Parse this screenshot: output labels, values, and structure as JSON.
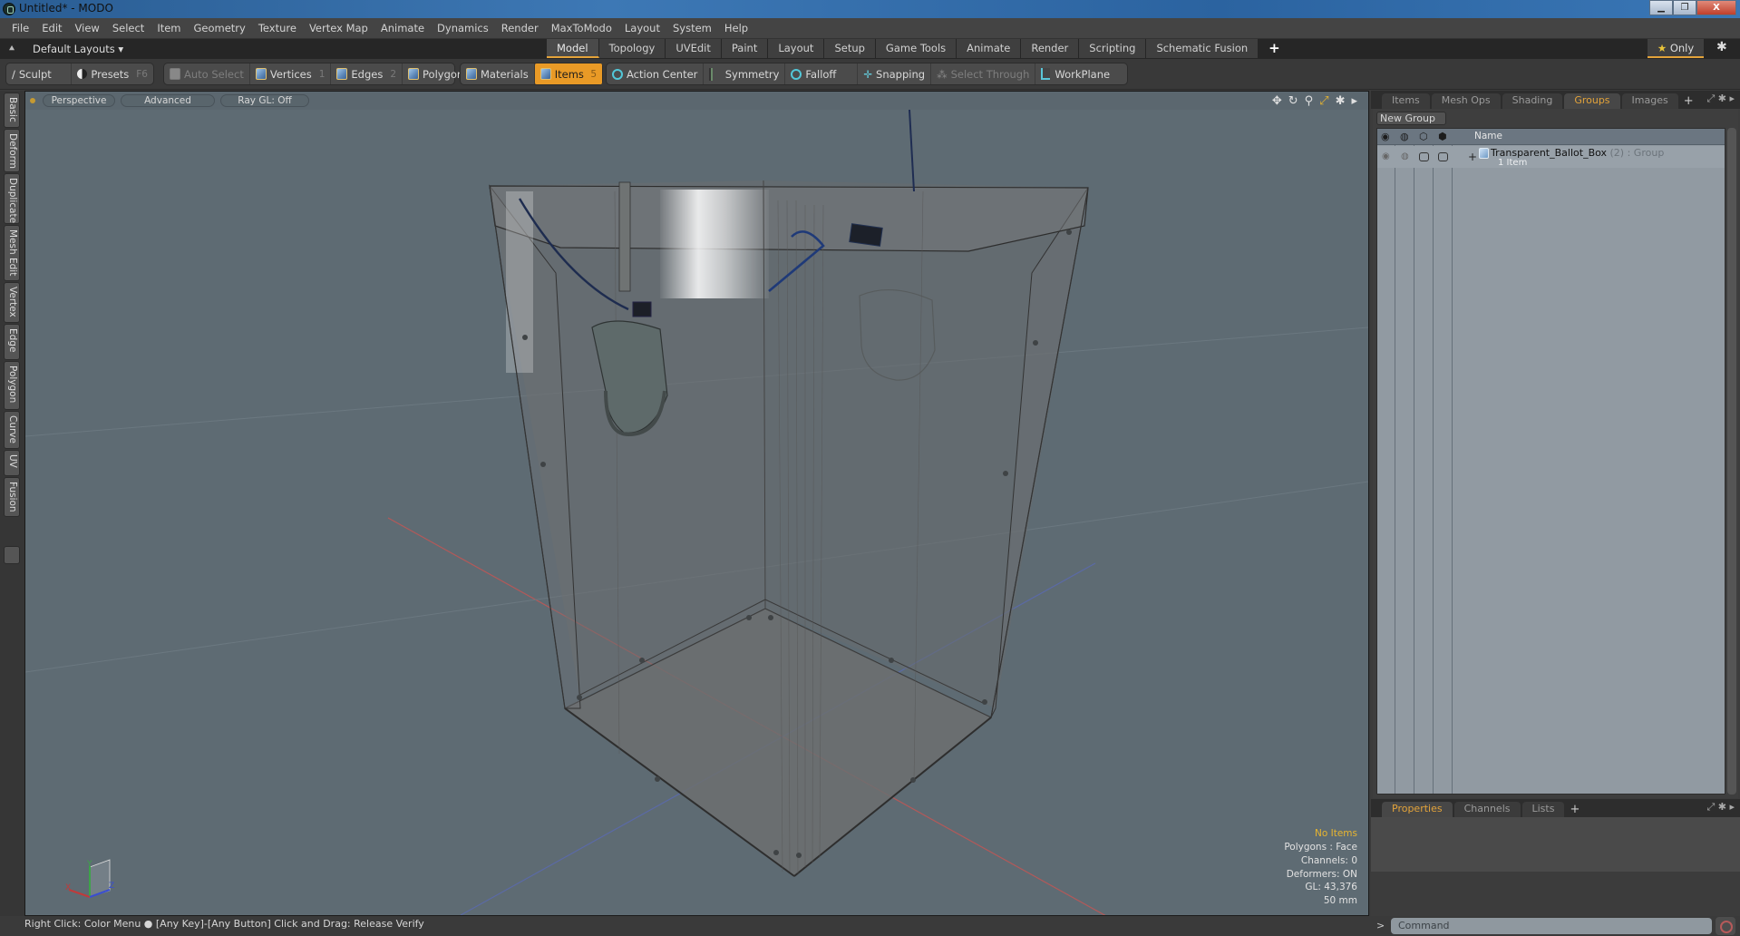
{
  "window": {
    "title": "Untitled* - MODO",
    "buttons": [
      "minimize",
      "restore",
      "close"
    ],
    "close_glyph": "X",
    "min_glyph": "▁",
    "restore_glyph": "❐"
  },
  "menu": [
    "File",
    "Edit",
    "View",
    "Select",
    "Item",
    "Geometry",
    "Texture",
    "Vertex Map",
    "Animate",
    "Dynamics",
    "Render",
    "MaxToModo",
    "Layout",
    "System",
    "Help"
  ],
  "layoutbar": {
    "layouts_dropdown": "Default Layouts ▾",
    "up_icon": "⯅",
    "tabs": [
      {
        "label": "Model",
        "active": true
      },
      {
        "label": "Topology"
      },
      {
        "label": "UVEdit"
      },
      {
        "label": "Paint"
      },
      {
        "label": "Layout"
      },
      {
        "label": "Setup"
      },
      {
        "label": "Game Tools"
      },
      {
        "label": "Animate"
      },
      {
        "label": "Render"
      },
      {
        "label": "Scripting"
      },
      {
        "label": "Schematic Fusion"
      }
    ],
    "add_tab": "+",
    "only_label": "Only",
    "star": "★",
    "gear": "✱"
  },
  "toolbar": {
    "sculpt": "Sculpt",
    "presets": "Presets",
    "presets_key": "F6",
    "auto_select": "Auto Select",
    "vertices": "Vertices",
    "vertices_key": "1",
    "edges": "Edges",
    "edges_key": "2",
    "polygons": "Polygons",
    "materials": "Materials",
    "items": "Items",
    "items_key": "5",
    "action_center": "Action Center",
    "symmetry": "Symmetry",
    "falloff": "Falloff",
    "snapping": "Snapping",
    "select_through": "Select Through",
    "workplane": "WorkPlane"
  },
  "viewport": {
    "view": "Perspective",
    "shading": "Advanced",
    "raygl": "Ray GL: Off",
    "tools": [
      "✥",
      "↻",
      "⚲",
      "⤢",
      "✱",
      "▸"
    ],
    "info": {
      "selection": "No Items",
      "polygons": "Polygons : Face",
      "channels": "Channels: 0",
      "deformers": "Deformers: ON",
      "gl": "GL: 43,376",
      "scale": "50 mm"
    },
    "axis": {
      "x": "X",
      "y": "Y",
      "z": "Z"
    }
  },
  "left_tabs": [
    "Basic",
    "Deform",
    "Duplicate",
    "Mesh Edit",
    "Vertex",
    "Edge",
    "Polygon",
    "Curve",
    "UV",
    "Fusion"
  ],
  "right_panel": {
    "tabs": [
      {
        "label": "Items"
      },
      {
        "label": "Mesh Ops"
      },
      {
        "label": "Shading"
      },
      {
        "label": "Groups",
        "active": true
      },
      {
        "label": "Images"
      }
    ],
    "add_tab": "+",
    "new_group": "New Group",
    "columns": {
      "name": "Name"
    },
    "groups": [
      {
        "name": "Transparent_Ballot_Box",
        "count": "(2)",
        "type": ": Group",
        "sub": "1 Item"
      }
    ],
    "bottom_tabs": [
      {
        "label": "Properties",
        "active": true
      },
      {
        "label": "Channels"
      },
      {
        "label": "Lists"
      }
    ],
    "panel_icons": "⤢ ✱ ▸"
  },
  "command": {
    "prompt": ">",
    "placeholder": "Command"
  },
  "status": "Right Click: Color Menu ● [Any Key]-[Any Button] Click and Drag: Release Verify",
  "colors": {
    "accent": "#e99a26",
    "viewport_bg": "#5e6b73",
    "active_tab_text": "#e3a33a"
  }
}
